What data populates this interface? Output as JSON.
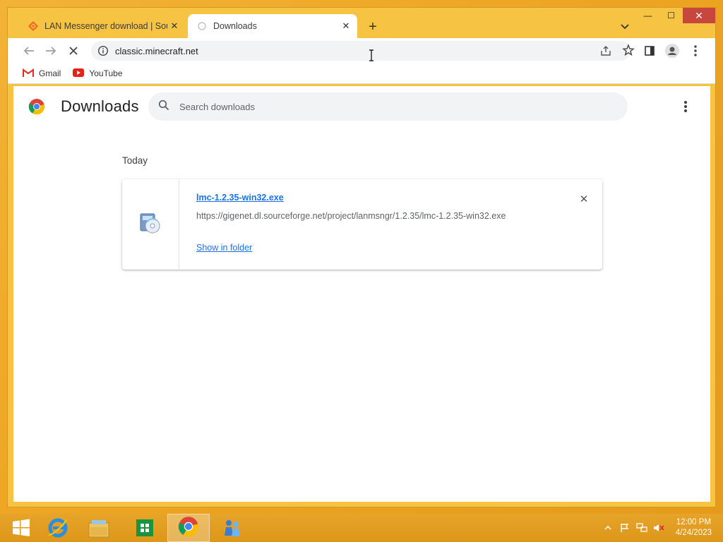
{
  "tabs": [
    {
      "title": "LAN Messenger download | SourceForge.net",
      "close_label": "✕",
      "active": false
    },
    {
      "title": "Downloads",
      "close_label": "✕",
      "active": true
    }
  ],
  "newtab_label": "+",
  "window_controls": {
    "minimize": "—",
    "maximize": "☐",
    "close": "✕"
  },
  "address_bar": {
    "url": "classic.minecraft.net"
  },
  "bookmarks": [
    {
      "label": "Gmail",
      "icon": "gmail-icon"
    },
    {
      "label": "YouTube",
      "icon": "youtube-icon"
    }
  ],
  "downloads_page": {
    "title": "Downloads",
    "search_placeholder": "Search downloads",
    "date_group": "Today",
    "item": {
      "file_name": "lmc-1.2.35-win32.exe",
      "source_url": "https://gigenet.dl.sourceforge.net/project/lanmsngr/1.2.35/lmc-1.2.35-win32.exe",
      "action_label": "Show in folder",
      "remove_label": "✕"
    }
  },
  "taskbar": {
    "items": [
      "start-button",
      "internet-explorer-icon",
      "file-explorer-icon",
      "store-icon",
      "chrome-icon",
      "messenger-icon"
    ],
    "clock_time": "12:00 PM",
    "clock_date": "4/24/2023"
  },
  "colors": {
    "accent": "#1a73e8",
    "window_frame": "#f6c342",
    "taskbar": "#e09b1d",
    "close_button": "#c7463e"
  }
}
